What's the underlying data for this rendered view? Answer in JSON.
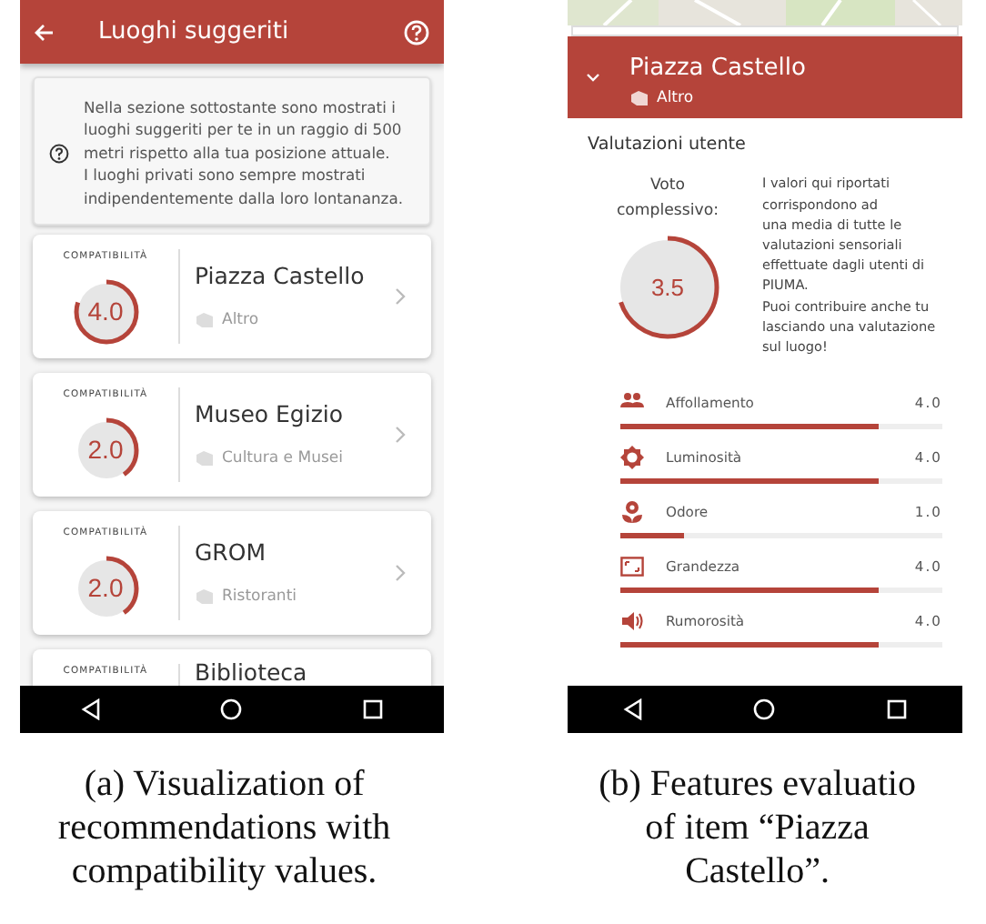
{
  "left": {
    "title": "Luoghi suggeriti",
    "info": [
      "Nella sezione sottostante sono mostrati i luoghi suggeriti per te in un raggio di 500 metri rispetto alla tua posizione attuale.",
      "I luoghi privati sono sempre mostrati indipendentemente dalla loro lontananza."
    ],
    "places": [
      {
        "compat_label": "COMPATIBILITÀ",
        "score": "4.0",
        "level": 0.8,
        "name": "Piazza Castello",
        "category": "Altro"
      },
      {
        "compat_label": "COMPATIBILITÀ",
        "score": "2.0",
        "level": 0.4,
        "name": "Museo Egizio",
        "category": "Cultura e Musei"
      },
      {
        "compat_label": "COMPATIBILITÀ",
        "score": "2.0",
        "level": 0.4,
        "name": "GROM",
        "category": "Ristoranti"
      },
      {
        "compat_label": "COMPATIBILITÀ",
        "name": "Biblioteca"
      }
    ],
    "caption": [
      "(a) Visualization of",
      "recommendations with",
      "compatibility values."
    ]
  },
  "right": {
    "title": "Piazza Castello",
    "category": "Altro",
    "section": "Valutazioni utente",
    "overall": {
      "label": [
        "Voto",
        "complessivo:"
      ],
      "score": "3.5",
      "level": 0.7
    },
    "description": [
      "I valori qui riportati corrispondono ad",
      "una media di tutte le valutazioni sensoriali effettuate dagli utenti di PIUMA.",
      "Puoi contribuire anche tu lasciando una valutazione sul luogo!"
    ],
    "features": [
      {
        "kind": "crowd",
        "label": "Affollamento",
        "value": "4.0",
        "level": 0.8
      },
      {
        "kind": "light",
        "label": "Luminosità",
        "value": "4.0",
        "level": 0.8
      },
      {
        "kind": "smell",
        "label": "Odore",
        "value": "1.0",
        "level": 0.2
      },
      {
        "kind": "size",
        "label": "Grandezza",
        "value": "4.0",
        "level": 0.8
      },
      {
        "kind": "noise",
        "label": "Rumorosità",
        "value": "4.0",
        "level": 0.8
      }
    ],
    "caption": [
      "(b) Features evaluatio",
      "of item “Piazza",
      "Castello”."
    ]
  }
}
